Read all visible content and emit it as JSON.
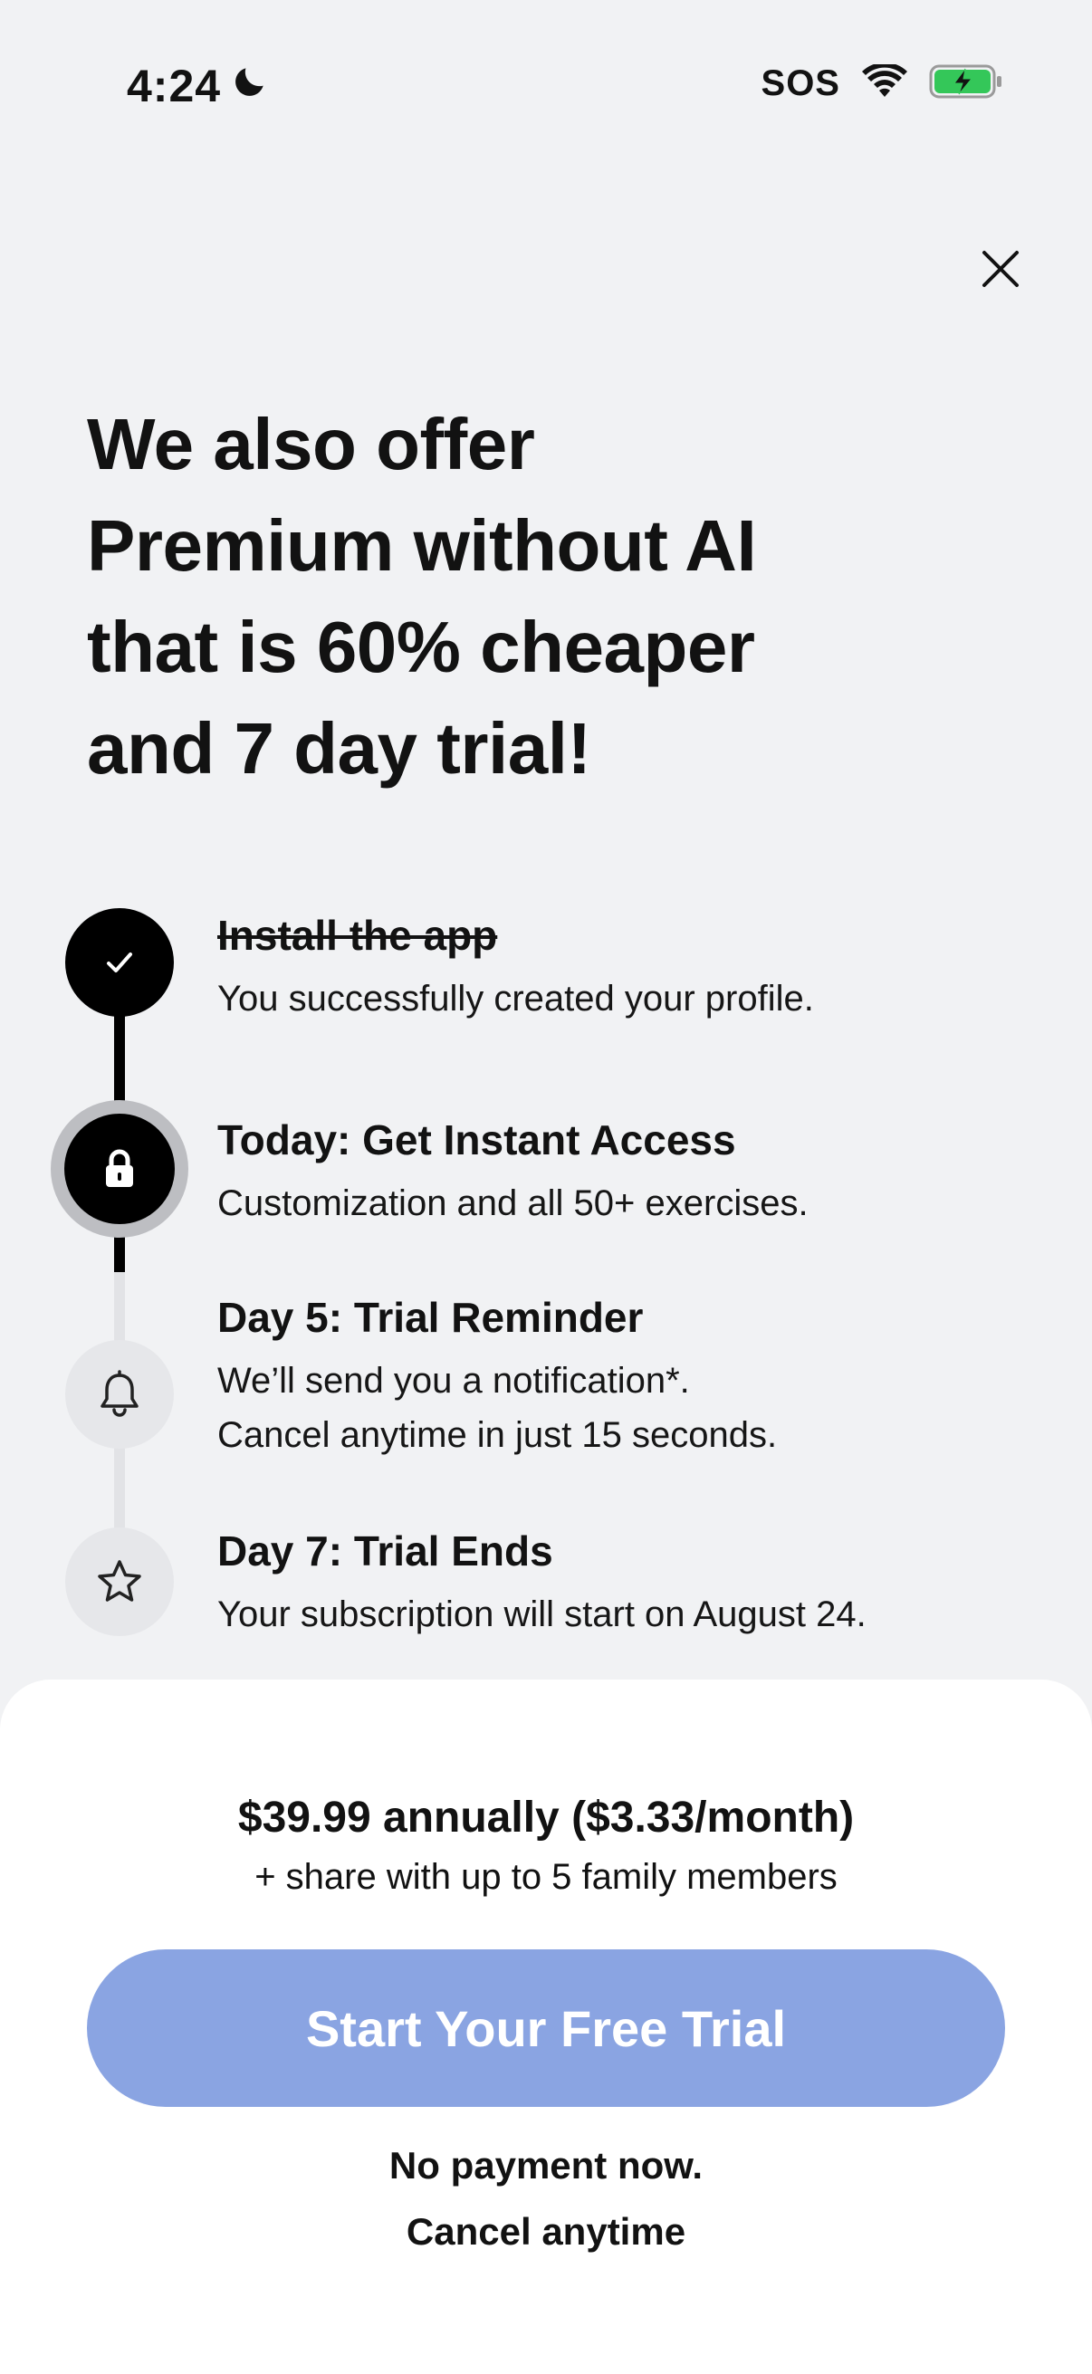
{
  "status_bar": {
    "time": "4:24",
    "carrier": "SOS",
    "icons": [
      "moon-icon",
      "wifi-icon",
      "battery-charging-icon"
    ],
    "battery_color": "#34c759"
  },
  "close": {
    "icon": "close-icon"
  },
  "headline": "We also offer\nPremium without AI\nthat is 60% cheaper\nand 7 day trial!",
  "timeline": {
    "steps": [
      {
        "title": "Install the app",
        "desc": "You successfully created your profile.",
        "icon": "checkmark-icon",
        "state": "done"
      },
      {
        "title": "Today: Get Instant Access",
        "desc": "Customization and all 50+ exercises.",
        "icon": "lock-icon",
        "state": "current"
      },
      {
        "title": "Day 5: Trial Reminder",
        "desc": "We’ll send you a notification*.\nCancel anytime in just 15 seconds.",
        "icon": "bell-icon",
        "state": "upcoming"
      },
      {
        "title": "Day 7: Trial Ends",
        "desc": "Your subscription will start on August 24.",
        "icon": "star-icon",
        "state": "upcoming"
      }
    ]
  },
  "sheet": {
    "price": "$39.99 annually ($3.33/month)",
    "share": "+ share with up to 5 family members",
    "cta_label": "Start Your Free Trial",
    "cta_color": "#8aa4e2",
    "no_payment": "No payment now.",
    "cancel": "Cancel anytime"
  }
}
